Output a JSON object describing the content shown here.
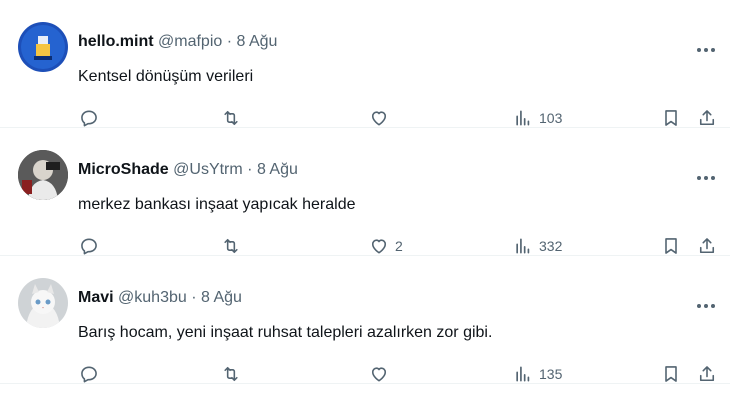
{
  "tweets": [
    {
      "name": "hello.mint",
      "handle": "@mafpio",
      "dot": "·",
      "date": "8 Ağu",
      "text": "Kentsel dönüşüm verileri",
      "likes": "",
      "views": "103"
    },
    {
      "name": "MicroShade",
      "handle": "@UsYtrm",
      "dot": "·",
      "date": "8 Ağu",
      "text": "merkez bankası inşaat yapıcak heralde",
      "likes": "2",
      "views": "332"
    },
    {
      "name": "Mavi",
      "handle": "@kuh3bu",
      "dot": "·",
      "date": "8 Ağu",
      "text": "Barış hocam, yeni inşaat ruhsat talepleri azalırken zor gibi.",
      "likes": "",
      "views": "135"
    }
  ],
  "icons": {
    "reply": "reply-icon",
    "retweet": "retweet-icon",
    "like": "like-icon",
    "views": "views-icon",
    "bookmark": "bookmark-icon",
    "share": "share-icon",
    "more": "more-icon"
  },
  "colors": {
    "text": "#0f1419",
    "muted": "#536471",
    "divider": "#eff3f4"
  }
}
